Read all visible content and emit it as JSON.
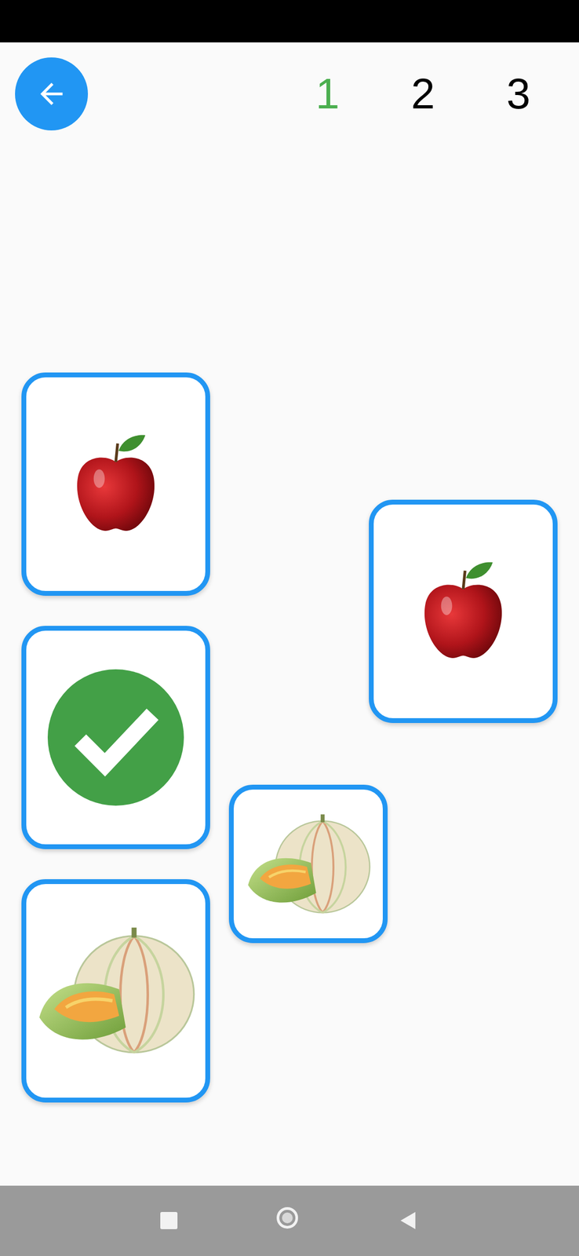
{
  "levels": [
    {
      "label": "1",
      "selected": true
    },
    {
      "label": "2",
      "selected": false
    },
    {
      "label": "3",
      "selected": false
    }
  ],
  "cards": [
    {
      "kind": "apple"
    },
    {
      "kind": "done"
    },
    {
      "kind": "melon"
    },
    {
      "kind": "apple"
    },
    {
      "kind": "melon"
    }
  ]
}
